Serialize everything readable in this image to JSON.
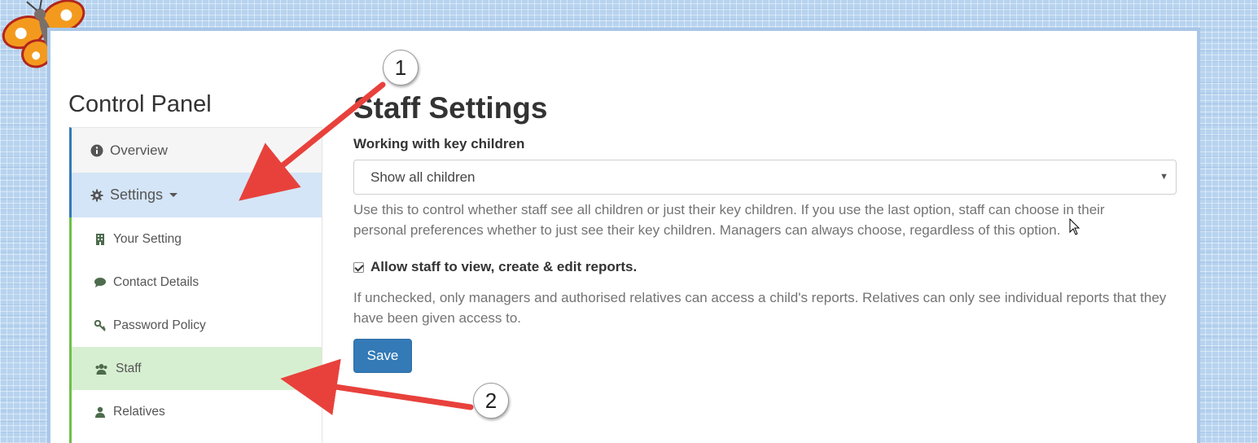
{
  "page": {
    "panel_title": "Control Panel",
    "heading": "Staff Settings"
  },
  "sidebar": {
    "overview": {
      "label": "Overview",
      "icon": "info-circle-icon"
    },
    "settings": {
      "label": "Settings",
      "icon": "gear-icon"
    },
    "sub_items": [
      {
        "label": "Your Setting",
        "icon": "building-icon"
      },
      {
        "label": "Contact Details",
        "icon": "comment-icon"
      },
      {
        "label": "Password Policy",
        "icon": "key-icon"
      },
      {
        "label": "Staff",
        "icon": "users-icon"
      },
      {
        "label": "Relatives",
        "icon": "user-icon"
      }
    ]
  },
  "form": {
    "key_children": {
      "label": "Working with key children",
      "selected": "Show all children",
      "help": "Use this to control whether staff see all children or just their key children. If you use the last option, staff can choose in their personal preferences whether to just see their key children. Managers can always choose, regardless of this option."
    },
    "reports": {
      "label": "Allow staff to view, create & edit reports.",
      "checked": true,
      "help": "If unchecked, only managers and authorised relatives can access a child's reports. Relatives can only see individual reports that they have been given access to."
    },
    "save_label": "Save"
  },
  "annotations": {
    "callout_1": "1",
    "callout_2": "2",
    "arrow_color": "#e8413c"
  },
  "colors": {
    "accent": "#337ab7",
    "settings_bg": "#d4e5f7",
    "active_sub_bg": "#d7efd1",
    "sub_border": "#6cc04a"
  }
}
